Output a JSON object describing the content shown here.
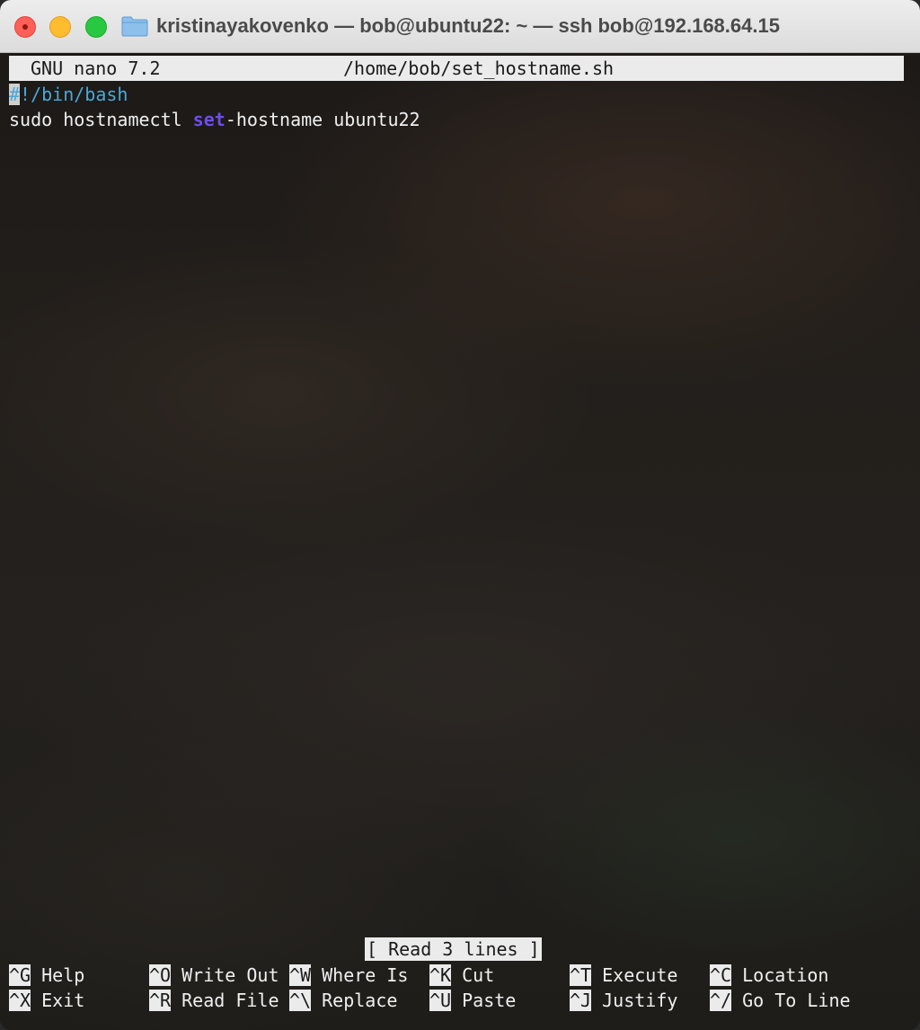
{
  "window": {
    "title": "kristinayakovenko — bob@ubuntu22: ~ — ssh bob@192.168.64.15",
    "folder_icon": "folder-icon"
  },
  "nano": {
    "version": "GNU nano 7.2",
    "file_path": "/home/bob/set_hostname.sh",
    "lines": {
      "shebang_cursor": "#",
      "shebang_rest": "!/bin/bash",
      "cmd_prefix": "sudo hostnamectl ",
      "cmd_keyword": "set",
      "cmd_suffix": "-hostname ubuntu22"
    },
    "status": "[ Read 3 lines ]",
    "shortcuts": [
      {
        "key": "^G",
        "label": "Help"
      },
      {
        "key": "^X",
        "label": "Exit"
      },
      {
        "key": "^O",
        "label": "Write Out"
      },
      {
        "key": "^R",
        "label": "Read File"
      },
      {
        "key": "^W",
        "label": "Where Is"
      },
      {
        "key": "^\\",
        "label": "Replace"
      },
      {
        "key": "^K",
        "label": "Cut"
      },
      {
        "key": "^U",
        "label": "Paste"
      },
      {
        "key": "^T",
        "label": "Execute"
      },
      {
        "key": "^J",
        "label": "Justify"
      },
      {
        "key": "^C",
        "label": "Location"
      },
      {
        "key": "^/",
        "label": "Go To Line"
      }
    ]
  },
  "colors": {
    "comment": "#4aa8d8",
    "keyword": "#6f4cf0",
    "header_bg": "#ebebeb"
  }
}
